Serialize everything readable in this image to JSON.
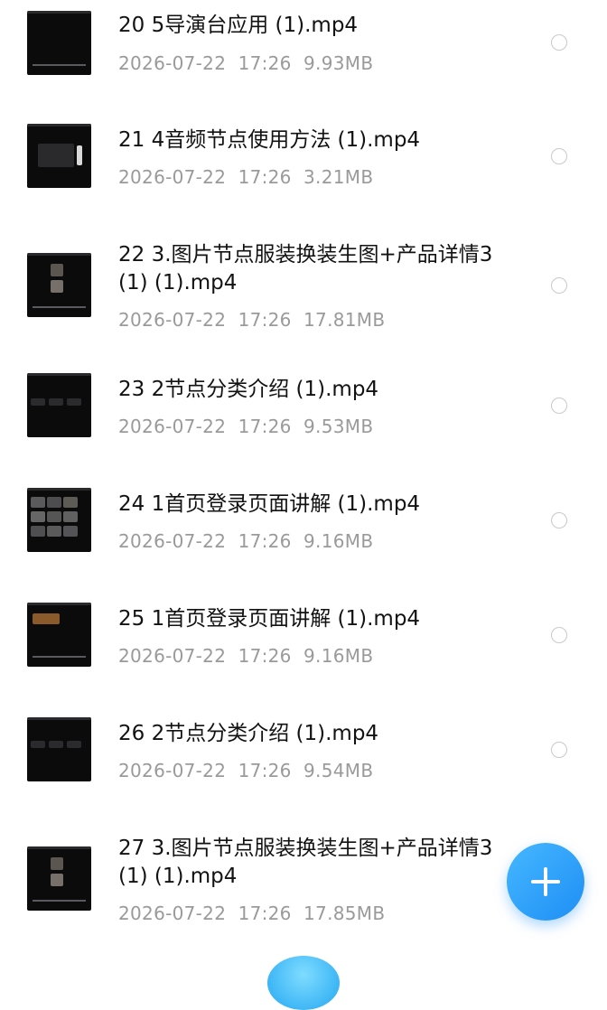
{
  "files": [
    {
      "title": "20 5导演台应用 (1).mp4",
      "date": "2026-07-22",
      "time": "17:26",
      "size": "9.93MB"
    },
    {
      "title": "21 4音频节点使用方法 (1).mp4",
      "date": "2026-07-22",
      "time": "17:26",
      "size": "3.21MB"
    },
    {
      "title": "22 3.图片节点服装换装生图+产品详情3 (1) (1).mp4",
      "date": "2026-07-22",
      "time": "17:26",
      "size": "17.81MB"
    },
    {
      "title": "23 2节点分类介绍 (1).mp4",
      "date": "2026-07-22",
      "time": "17:26",
      "size": "9.53MB"
    },
    {
      "title": "24 1首页登录页面讲解 (1).mp4",
      "date": "2026-07-22",
      "time": "17:26",
      "size": "9.16MB"
    },
    {
      "title": "25 1首页登录页面讲解 (1).mp4",
      "date": "2026-07-22",
      "time": "17:26",
      "size": "9.16MB"
    },
    {
      "title": "26 2节点分类介绍 (1).mp4",
      "date": "2026-07-22",
      "time": "17:26",
      "size": "9.54MB"
    },
    {
      "title": "27 3.图片节点服装换装生图+产品详情3 (1) (1).mp4",
      "date": "2026-07-22",
      "time": "17:26",
      "size": "17.85MB"
    }
  ],
  "icons": {
    "add": "plus-icon",
    "select": "radio-circle-icon"
  },
  "colors": {
    "accent": "#1f8ef5",
    "title": "#121212",
    "meta": "#9a9a9a"
  }
}
